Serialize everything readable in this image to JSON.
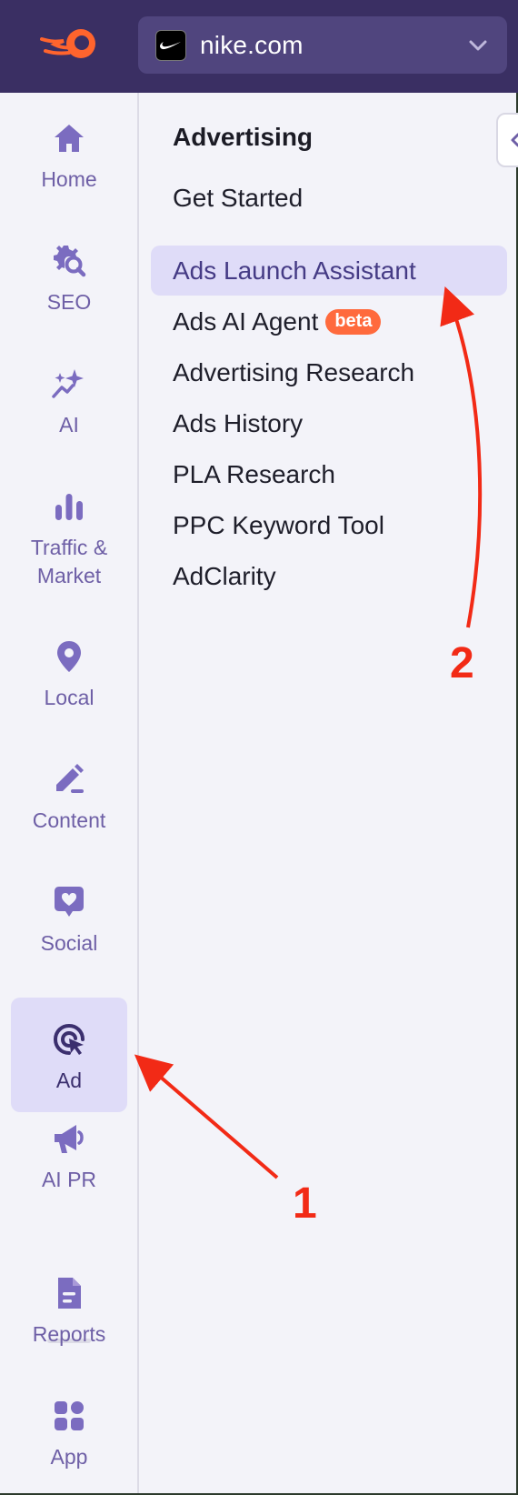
{
  "header": {
    "domain": "nike.com",
    "colors": {
      "bar": "#3a2f63",
      "select": "#50457e",
      "brand": "#ff642d"
    }
  },
  "rail": {
    "items": [
      {
        "label": "Home",
        "icon": "home-icon"
      },
      {
        "label": "SEO",
        "icon": "seo-gear-search-icon"
      },
      {
        "label": "AI",
        "icon": "ai-sparkle-icon"
      },
      {
        "label": "Traffic &\nMarket",
        "icon": "bar-chart-icon"
      },
      {
        "label": "Local",
        "icon": "map-pin-icon"
      },
      {
        "label": "Content",
        "icon": "pencil-icon"
      },
      {
        "label": "Social",
        "icon": "heart-message-icon"
      },
      {
        "label": "Ad",
        "icon": "target-cursor-icon",
        "active": true
      },
      {
        "label": "AI PR",
        "icon": "megaphone-icon"
      },
      {
        "label": "Reports",
        "icon": "document-icon"
      },
      {
        "label": "App",
        "icon": "apps-grid-icon"
      }
    ]
  },
  "panel": {
    "title": "Advertising",
    "items": [
      {
        "label": "Get Started"
      },
      {
        "label": "Ads Launch Assistant",
        "selected": true
      },
      {
        "label": "Ads AI Agent",
        "badge": "beta"
      },
      {
        "label": "Advertising Research"
      },
      {
        "label": "Ads History"
      },
      {
        "label": "PLA Research"
      },
      {
        "label": "PPC Keyword Tool"
      },
      {
        "label": "AdClarity"
      }
    ]
  },
  "annotations": {
    "step1": "1",
    "step2": "2",
    "color": "#f22a16"
  }
}
